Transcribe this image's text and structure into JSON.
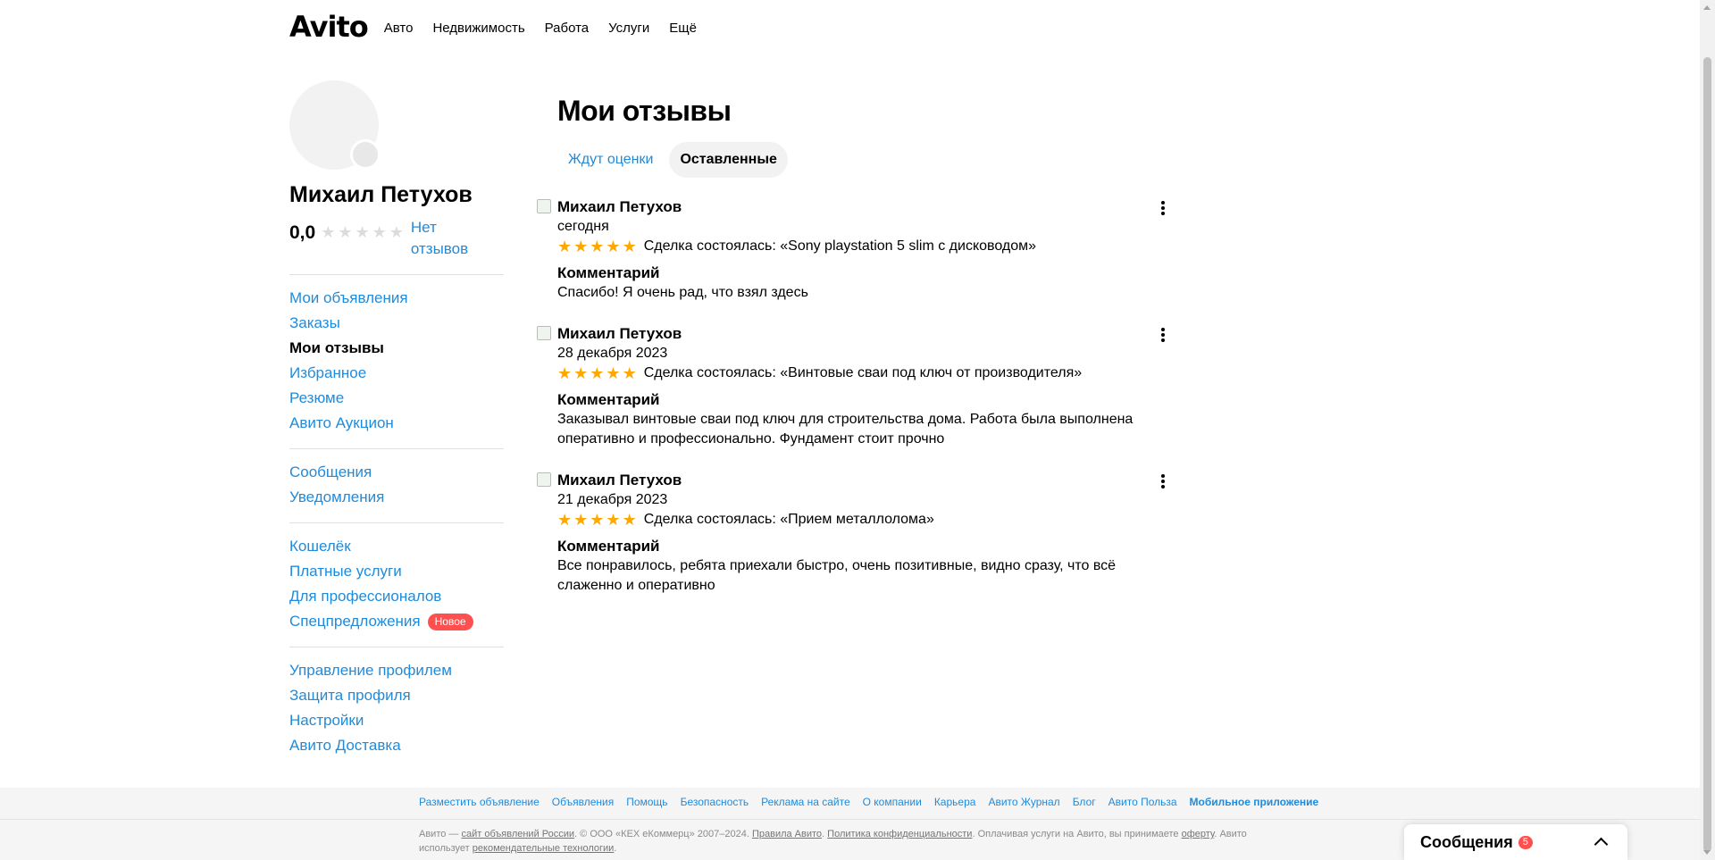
{
  "header": {
    "logo": "Avito",
    "nav": [
      "Авто",
      "Недвижимость",
      "Работа",
      "Услуги",
      "Ещё"
    ]
  },
  "profile": {
    "name": "Михаил Петухов",
    "rating": "0,0",
    "rating_stars": 0,
    "no_reviews": "Нет отзывов"
  },
  "sidebar": {
    "groups": [
      [
        {
          "label": "Мои объявления"
        },
        {
          "label": "Заказы"
        },
        {
          "label": "Мои отзывы",
          "active": true
        },
        {
          "label": "Избранное"
        },
        {
          "label": "Резюме"
        },
        {
          "label": "Авито Аукцион"
        }
      ],
      [
        {
          "label": "Сообщения"
        },
        {
          "label": "Уведомления"
        }
      ],
      [
        {
          "label": "Кошелёк"
        },
        {
          "label": "Платные услуги"
        },
        {
          "label": "Для профессионалов"
        },
        {
          "label": "Спецпредложения",
          "badge": "Новое"
        }
      ],
      [
        {
          "label": "Управление профилем"
        },
        {
          "label": "Защита профиля"
        },
        {
          "label": "Настройки"
        },
        {
          "label": "Авито Доставка"
        }
      ]
    ]
  },
  "main": {
    "title": "Мои отзывы",
    "tabs": [
      {
        "label": "Ждут оценки",
        "active": false
      },
      {
        "label": "Оставленные",
        "active": true
      }
    ],
    "comment_label": "Комментарий",
    "reviews": [
      {
        "author": "Михаил Петухов",
        "date": "сегодня",
        "stars": 5,
        "deal": "Сделка состоялась: «Sony playstation 5 slim с дисководом»",
        "comment": "Спасибо! Я очень рад, что взял здесь"
      },
      {
        "author": "Михаил Петухов",
        "date": "28 декабря 2023",
        "stars": 5,
        "deal": "Сделка состоялась: «Винтовые сваи под ключ от производителя»",
        "comment": "Заказывал винтовые сваи под ключ для строительства дома. Работа была выполнена оперативно и профессионально. Фундамент стоит прочно"
      },
      {
        "author": "Михаил Петухов",
        "date": "21 декабря 2023",
        "stars": 5,
        "deal": "Сделка состоялась: «Прием металлолома»",
        "comment": "Все понравилось, ребята приехали быстро, очень позитивные, видно сразу, что всё слаженно и оперативно"
      }
    ]
  },
  "footer": {
    "links": [
      "Разместить объявление",
      "Объявления",
      "Помощь",
      "Безопасность",
      "Реклама на сайте",
      "О компании",
      "Карьера",
      "Авито Журнал",
      "Блог",
      "Авито Польза"
    ],
    "mobile_link": "Мобильное приложение",
    "legal": {
      "t1": "Авито — ",
      "l1": "сайт объявлений России",
      "t2": ". © ООО «КЕХ еКоммерц» 2007–2024. ",
      "l2": "Правила Авито",
      "t3": ". ",
      "l3": "Политика конфиденциальности",
      "t4": ". Оплачивая услуги на Авито, вы принимаете ",
      "l4": "оферту",
      "t5": ". Авито использует ",
      "l5": "рекомендательные технологии",
      "t6": "."
    }
  },
  "messenger": {
    "title": "Сообщения",
    "count": "5"
  },
  "colors": {
    "link": "#1f8bdc",
    "star": "#ffa800",
    "badge": "#ff4f4f"
  }
}
